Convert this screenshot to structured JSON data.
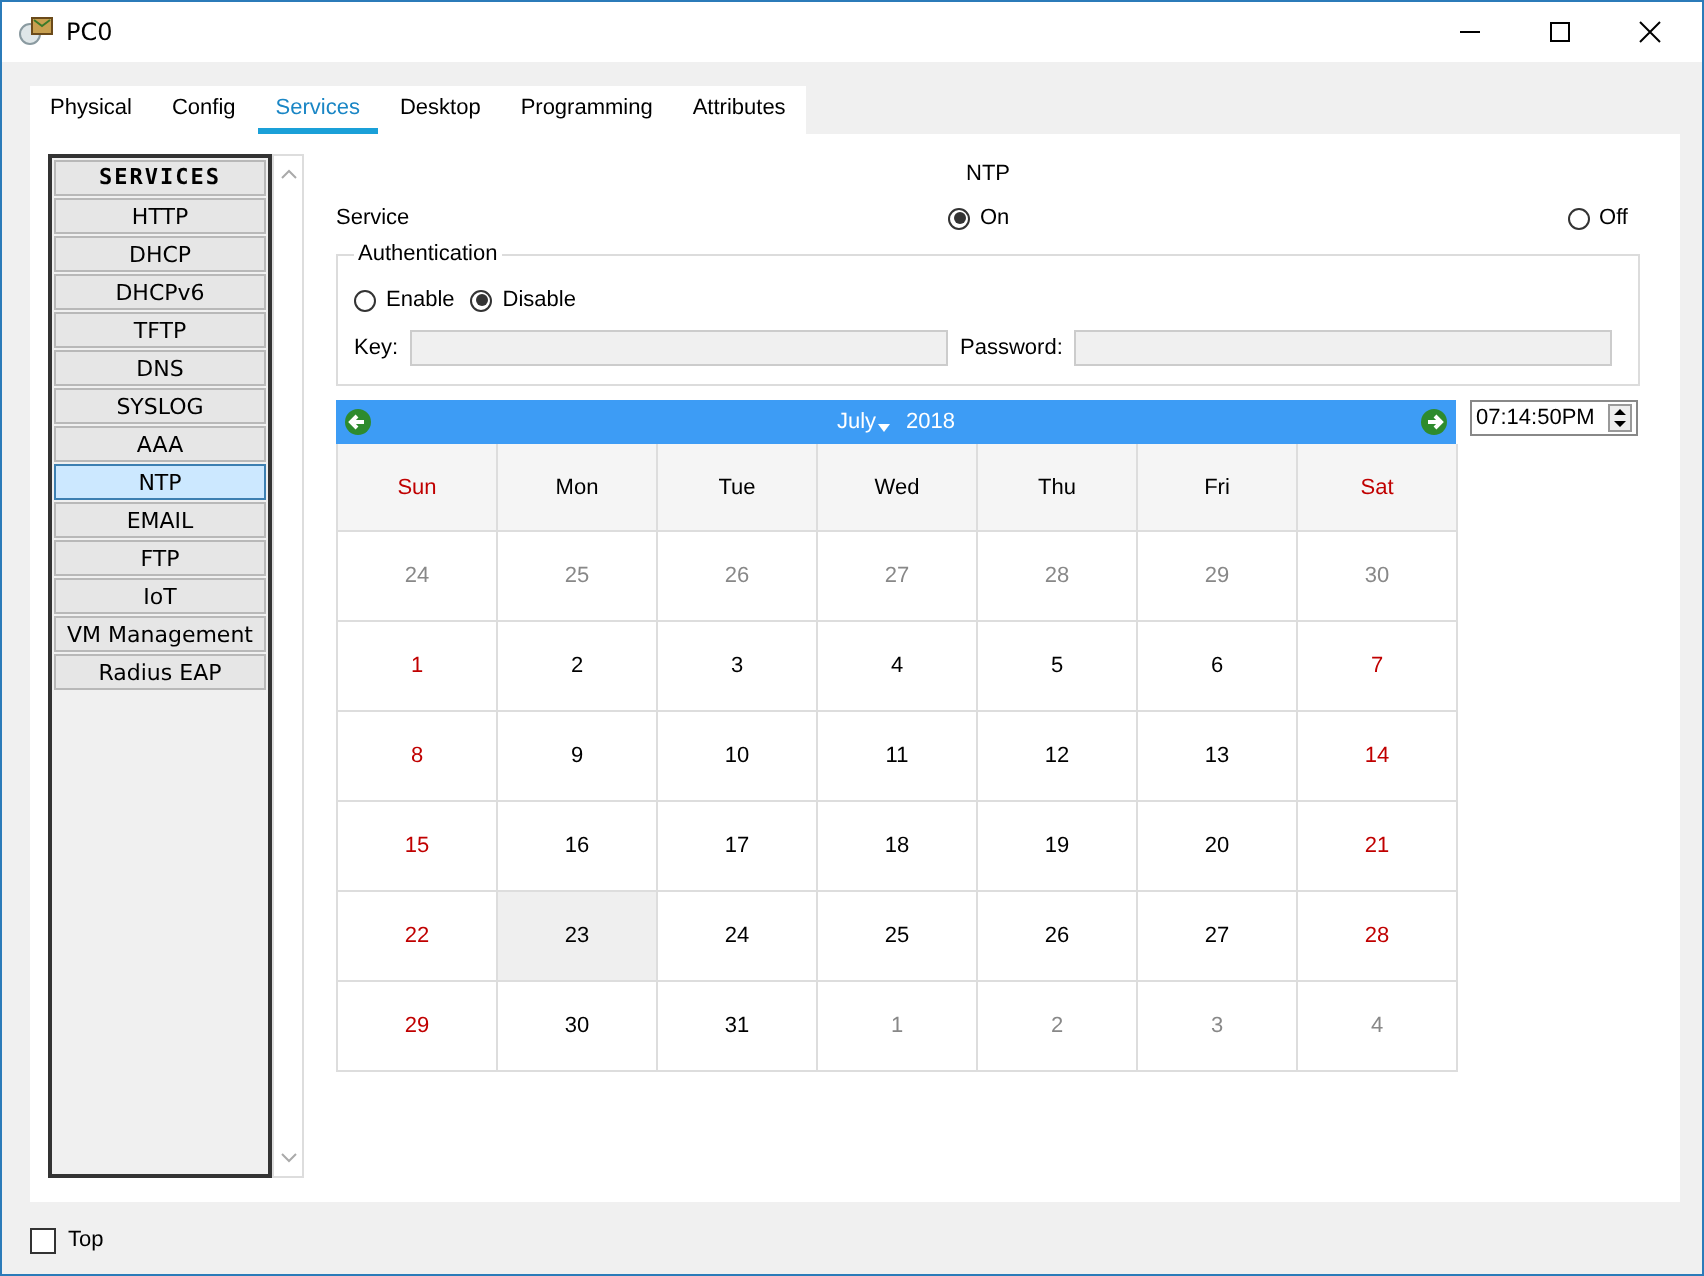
{
  "window": {
    "title": "PC0"
  },
  "tabs": [
    {
      "label": "Physical",
      "selected": false
    },
    {
      "label": "Config",
      "selected": false
    },
    {
      "label": "Services",
      "selected": true
    },
    {
      "label": "Desktop",
      "selected": false
    },
    {
      "label": "Programming",
      "selected": false
    },
    {
      "label": "Attributes",
      "selected": false
    }
  ],
  "sidebar": {
    "header": "SERVICES",
    "items": [
      {
        "label": "HTTP",
        "selected": false
      },
      {
        "label": "DHCP",
        "selected": false
      },
      {
        "label": "DHCPv6",
        "selected": false
      },
      {
        "label": "TFTP",
        "selected": false
      },
      {
        "label": "DNS",
        "selected": false
      },
      {
        "label": "SYSLOG",
        "selected": false
      },
      {
        "label": "AAA",
        "selected": false
      },
      {
        "label": "NTP",
        "selected": true
      },
      {
        "label": "EMAIL",
        "selected": false
      },
      {
        "label": "FTP",
        "selected": false
      },
      {
        "label": "IoT",
        "selected": false
      },
      {
        "label": "VM Management",
        "selected": false
      },
      {
        "label": "Radius EAP",
        "selected": false
      }
    ]
  },
  "panel": {
    "title": "NTP",
    "service_label": "Service",
    "service_options": [
      {
        "label": "On",
        "selected": true
      },
      {
        "label": "Off",
        "selected": false
      }
    ],
    "authentication": {
      "title": "Authentication",
      "options": [
        {
          "label": "Enable",
          "selected": false
        },
        {
          "label": "Disable",
          "selected": true
        }
      ],
      "key_label": "Key:",
      "password_label": "Password:"
    }
  },
  "calendar": {
    "month": "July",
    "year": "2018",
    "time": "07:14:50PM",
    "weekdays": [
      "Sun",
      "Mon",
      "Tue",
      "Wed",
      "Thu",
      "Fri",
      "Sat"
    ],
    "weeks": [
      [
        {
          "day": "24",
          "outside": true,
          "selected": false
        },
        {
          "day": "25",
          "outside": true,
          "selected": false
        },
        {
          "day": "26",
          "outside": true,
          "selected": false
        },
        {
          "day": "27",
          "outside": true,
          "selected": false
        },
        {
          "day": "28",
          "outside": true,
          "selected": false
        },
        {
          "day": "29",
          "outside": true,
          "selected": false
        },
        {
          "day": "30",
          "outside": true,
          "selected": false
        }
      ],
      [
        {
          "day": "1",
          "outside": false,
          "selected": false
        },
        {
          "day": "2",
          "outside": false,
          "selected": false
        },
        {
          "day": "3",
          "outside": false,
          "selected": false
        },
        {
          "day": "4",
          "outside": false,
          "selected": false
        },
        {
          "day": "5",
          "outside": false,
          "selected": false
        },
        {
          "day": "6",
          "outside": false,
          "selected": false
        },
        {
          "day": "7",
          "outside": false,
          "selected": false
        }
      ],
      [
        {
          "day": "8",
          "outside": false,
          "selected": false
        },
        {
          "day": "9",
          "outside": false,
          "selected": false
        },
        {
          "day": "10",
          "outside": false,
          "selected": false
        },
        {
          "day": "11",
          "outside": false,
          "selected": false
        },
        {
          "day": "12",
          "outside": false,
          "selected": false
        },
        {
          "day": "13",
          "outside": false,
          "selected": false
        },
        {
          "day": "14",
          "outside": false,
          "selected": false
        }
      ],
      [
        {
          "day": "15",
          "outside": false,
          "selected": false
        },
        {
          "day": "16",
          "outside": false,
          "selected": false
        },
        {
          "day": "17",
          "outside": false,
          "selected": false
        },
        {
          "day": "18",
          "outside": false,
          "selected": false
        },
        {
          "day": "19",
          "outside": false,
          "selected": false
        },
        {
          "day": "20",
          "outside": false,
          "selected": false
        },
        {
          "day": "21",
          "outside": false,
          "selected": false
        }
      ],
      [
        {
          "day": "22",
          "outside": false,
          "selected": false
        },
        {
          "day": "23",
          "outside": false,
          "selected": true
        },
        {
          "day": "24",
          "outside": false,
          "selected": false
        },
        {
          "day": "25",
          "outside": false,
          "selected": false
        },
        {
          "day": "26",
          "outside": false,
          "selected": false
        },
        {
          "day": "27",
          "outside": false,
          "selected": false
        },
        {
          "day": "28",
          "outside": false,
          "selected": false
        }
      ],
      [
        {
          "day": "29",
          "outside": false,
          "selected": false
        },
        {
          "day": "30",
          "outside": false,
          "selected": false
        },
        {
          "day": "31",
          "outside": false,
          "selected": false
        },
        {
          "day": "1",
          "outside": true,
          "selected": false
        },
        {
          "day": "2",
          "outside": true,
          "selected": false
        },
        {
          "day": "3",
          "outside": true,
          "selected": false
        },
        {
          "day": "4",
          "outside": true,
          "selected": false
        }
      ]
    ]
  },
  "footer": {
    "top_label": "Top",
    "top_checked": false
  }
}
